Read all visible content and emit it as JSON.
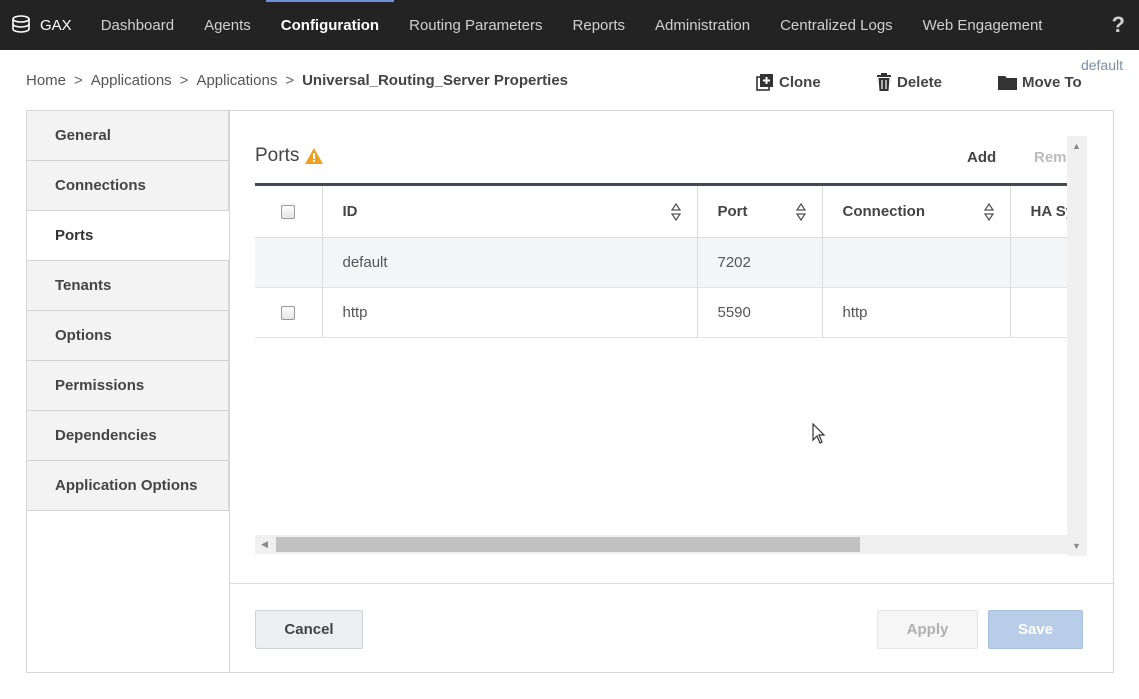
{
  "topnav": {
    "brand": "GAX",
    "items": [
      {
        "label": "Dashboard"
      },
      {
        "label": "Agents"
      },
      {
        "label": "Configuration",
        "active": true
      },
      {
        "label": "Routing Parameters"
      },
      {
        "label": "Reports"
      },
      {
        "label": "Administration"
      },
      {
        "label": "Centralized Logs"
      },
      {
        "label": "Web Engagement"
      }
    ],
    "help": "?"
  },
  "breadcrumb": {
    "items": [
      "Home",
      "Applications",
      "Applications"
    ],
    "separator": ">",
    "current": "Universal_Routing_Server Properties"
  },
  "tenant": "default",
  "actions": {
    "clone": "Clone",
    "delete": "Delete",
    "move_to": "Move To"
  },
  "sidebar": {
    "tabs": [
      {
        "label": "General"
      },
      {
        "label": "Connections"
      },
      {
        "label": "Ports",
        "active": true
      },
      {
        "label": "Tenants"
      },
      {
        "label": "Options"
      },
      {
        "label": "Permissions"
      },
      {
        "label": "Dependencies"
      },
      {
        "label": "Application Options"
      }
    ]
  },
  "panel": {
    "title": "Ports",
    "warning_icon": "warning-icon",
    "add_label": "Add",
    "remove_label": "Remove"
  },
  "grid": {
    "columns": [
      "ID",
      "Port",
      "Connection",
      "HA Sync"
    ],
    "rows": [
      {
        "id": "default",
        "port": "7202",
        "connection": "",
        "has_checkbox": false
      },
      {
        "id": "http",
        "port": "5590",
        "connection": "http",
        "has_checkbox": true
      }
    ]
  },
  "footer": {
    "cancel": "Cancel",
    "apply": "Apply",
    "save": "Save"
  },
  "colors": {
    "nav_bg": "#232323",
    "accent": "#6f8fd8",
    "save_disabled": "#b8cde8",
    "warning": "#f0a020"
  }
}
